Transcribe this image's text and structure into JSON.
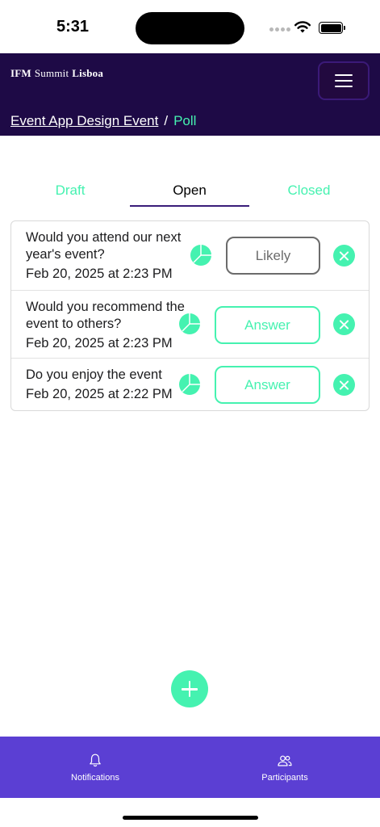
{
  "status_bar": {
    "time": "5:31"
  },
  "header": {
    "brand": {
      "part1": "IFM",
      "part2": "Summit",
      "part3": "Lisboa"
    },
    "menu_icon": "hamburger-icon",
    "breadcrumb": {
      "parent": "Event App Design Event",
      "separator": "/",
      "current": "Poll"
    }
  },
  "tabs": [
    {
      "label": "Draft",
      "active": false
    },
    {
      "label": "Open",
      "active": true
    },
    {
      "label": "Closed",
      "active": false
    }
  ],
  "polls": [
    {
      "question": "Would you attend our next year's event?",
      "date": "Feb 20, 2025 at 2:23 PM",
      "action": "Likely"
    },
    {
      "question": "Would you recommend the event to others?",
      "date": "Feb 20, 2025 at 2:23 PM",
      "action": "Answer"
    },
    {
      "question": "Do you enjoy the event",
      "date": "Feb 20, 2025 at 2:22 PM",
      "action": "Answer"
    }
  ],
  "fab_icon": "plus-icon",
  "bottom_nav": [
    {
      "label": "Notifications",
      "icon": "bell-icon"
    },
    {
      "label": "Participants",
      "icon": "users-icon"
    }
  ],
  "colors": {
    "header_bg": "#1e0a46",
    "accent": "#45f2b0",
    "nav_bg": "#5b3fd3",
    "tab_underline": "#3a1d7a"
  }
}
